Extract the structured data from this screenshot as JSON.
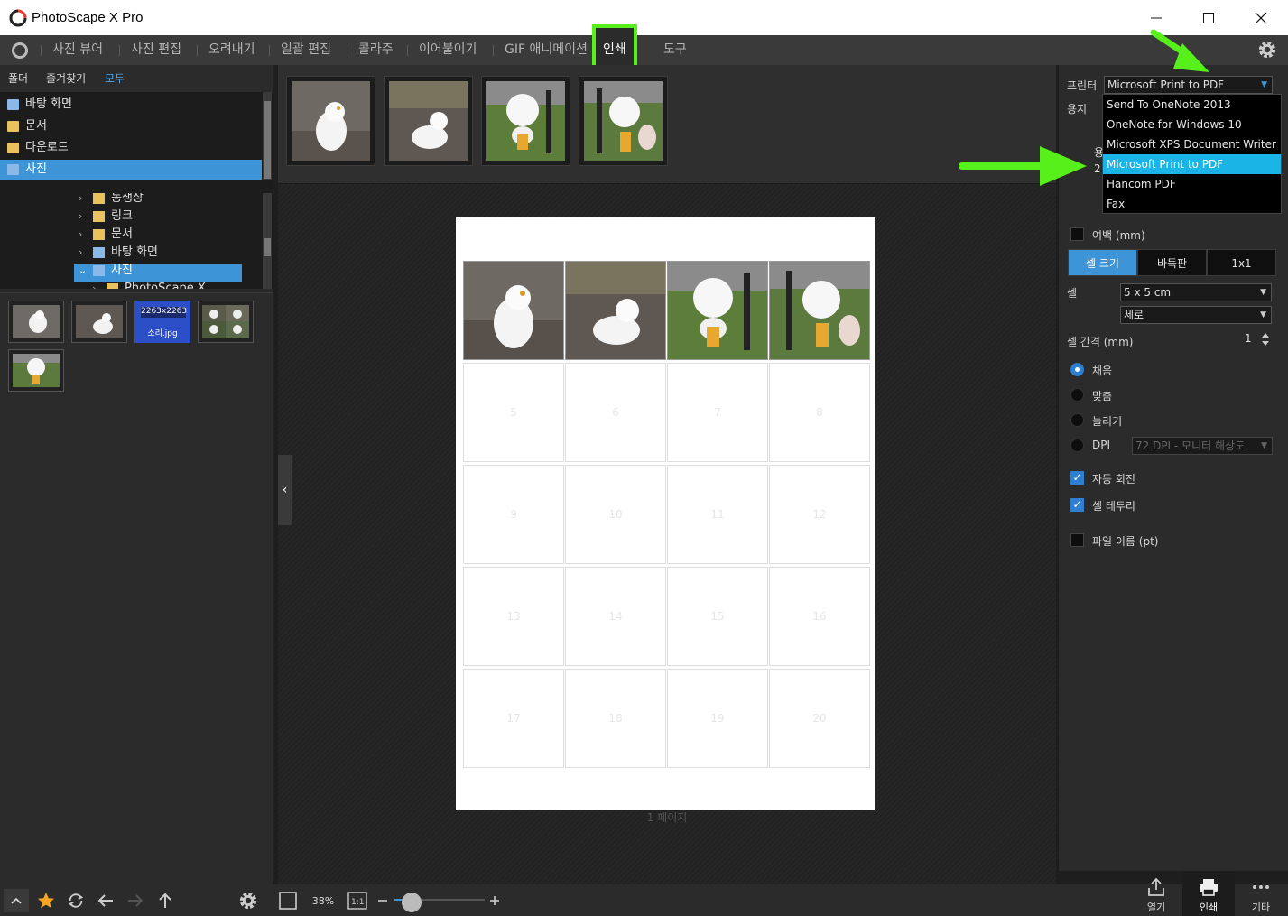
{
  "window": {
    "title": "PhotoScape X Pro"
  },
  "menu": {
    "items": [
      "사진 뷰어",
      "사진 편집",
      "오려내기",
      "일괄 편집",
      "콜라주",
      "이어붙이기",
      "GIF 애니메이션",
      "인쇄",
      "도구"
    ]
  },
  "left": {
    "tabs": [
      "폴더",
      "즐겨찾기",
      "모두"
    ],
    "favorites": [
      "바탕 화면",
      "문서",
      "다운로드",
      "사진"
    ],
    "tree": [
      "농생상",
      "링크",
      "문서",
      "바탕 화면",
      "사진",
      "PhotoScape X"
    ],
    "thumb_selected_size": "2263x2263",
    "thumb_selected_name": "소리.jpg"
  },
  "canvas": {
    "cell_numbers": [
      "5",
      "6",
      "7",
      "8",
      "9",
      "10",
      "11",
      "12",
      "13",
      "14",
      "15",
      "16",
      "17",
      "18",
      "19",
      "20"
    ],
    "page_label": "1 페이지"
  },
  "right": {
    "printer_label": "프린터",
    "printer_value": "Microsoft Print to PDF",
    "paper_label": "용지",
    "paper_partial_1": "용",
    "paper_partial_2": "2",
    "printer_options": [
      "Send To OneNote 2013",
      "OneNote for Windows 10",
      "Microsoft XPS Document Writer",
      "Microsoft Print to PDF",
      "Hancom PDF",
      "Fax"
    ],
    "margin_label": "여백 (mm)",
    "seg": [
      "셀 크기",
      "바둑판",
      "1x1"
    ],
    "cell_label": "셀",
    "cell_size": "5 x 5 cm",
    "orientation": "세로",
    "gap_label": "셀 간격 (mm)",
    "gap_value": "1",
    "fill_options": [
      "채움",
      "맞춤",
      "늘리기",
      "DPI"
    ],
    "dpi_value": "72 DPI - 모니터 해상도",
    "auto_rotate": "자동 회전",
    "cell_border": "셀 테두리",
    "filename_label": "파일 이름 (pt)"
  },
  "bottom": {
    "zoom": "38%",
    "actions": [
      "열기",
      "인쇄",
      "기타"
    ]
  },
  "colors": {
    "accent": "#3d95d8",
    "highlight": "#57f01b",
    "dropdown_sel": "#1ab4e6"
  }
}
